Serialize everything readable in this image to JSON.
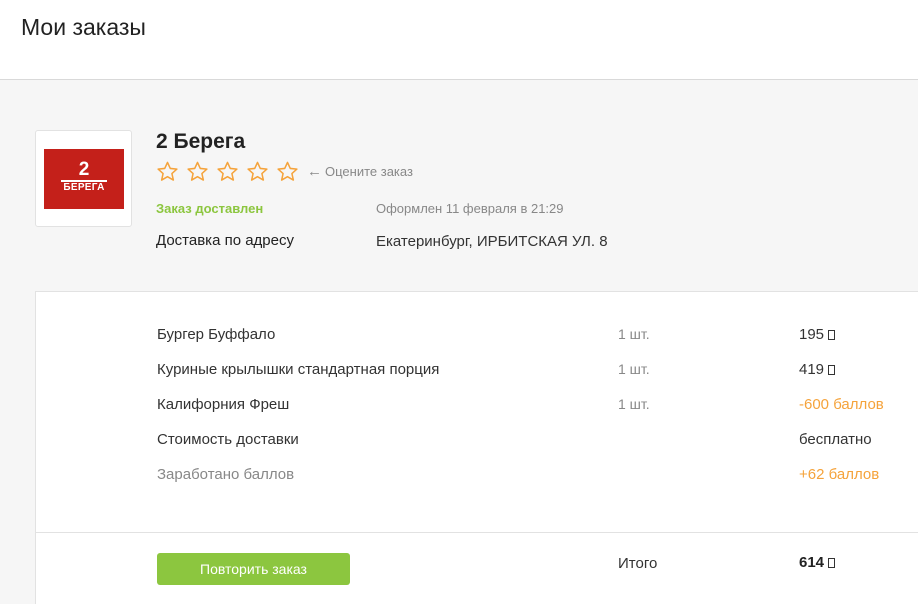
{
  "header": {
    "title": "Мои заказы"
  },
  "order": {
    "restaurant": {
      "name": "2 Берега",
      "logo": {
        "number": "2",
        "word": "БЕРЕГА",
        "color": "#c4201a"
      }
    },
    "rating": {
      "stars_total": 5,
      "stars_filled": 0,
      "hint": "Оцените заказ",
      "star_color": "#f5a33b"
    },
    "status": "Заказ доставлен",
    "ordered_at": "Оформлен 11 февраля в 21:29",
    "delivery_label": "Доставка по адресу",
    "address": "Екатеринбург, ИРБИТСКАЯ УЛ. 8",
    "items": [
      {
        "name": "Бургер Буффало",
        "qty": "1 шт.",
        "price": "195",
        "price_style": "normal"
      },
      {
        "name": "Куриные крылышки стандартная порция",
        "qty": "1 шт.",
        "price": "419",
        "price_style": "normal"
      },
      {
        "name": "Калифорния Фреш",
        "qty": "1 шт.",
        "price": "-600 баллов",
        "price_style": "orange"
      }
    ],
    "delivery_cost": {
      "label": "Стоимость доставки",
      "value": "бесплатно"
    },
    "earned_points": {
      "label": "Заработано баллов",
      "value": "+62 баллов"
    },
    "repeat_button": "Повторить заказ",
    "total": {
      "label": "Итого",
      "value": "614"
    },
    "colors": {
      "accent_green": "#8cc63f",
      "accent_orange": "#f5a33b"
    }
  }
}
